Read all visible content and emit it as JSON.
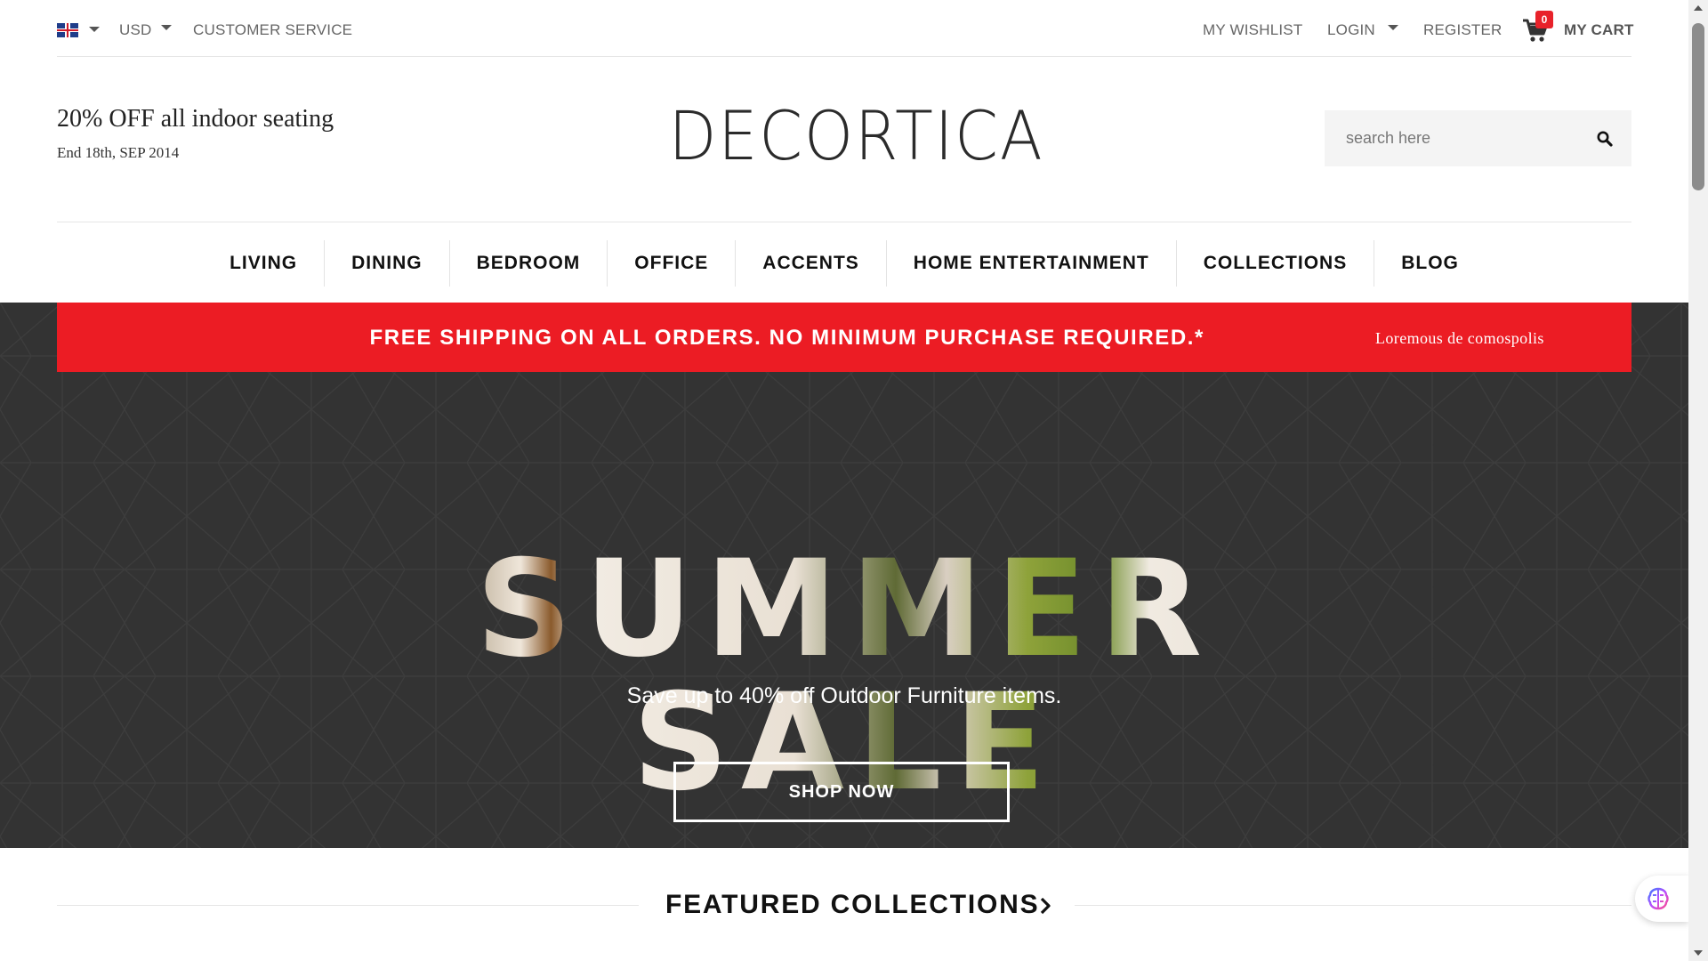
{
  "topbar": {
    "language_icon": "uk-flag-icon",
    "currency": "USD",
    "customer_service": "CUSTOMER SERVICE",
    "wishlist": "MY WISHLIST",
    "login": "LOGIN",
    "register": "REGISTER",
    "cart_count": "0",
    "cart_label": "MY CART"
  },
  "header": {
    "promo_title": "20% OFF all indoor seating",
    "promo_date": "End 18th, SEP 2014",
    "logo": "DECORTICA",
    "search_placeholder": "search here"
  },
  "nav": {
    "items": [
      {
        "label": "LIVING"
      },
      {
        "label": "DINING"
      },
      {
        "label": "BEDROOM"
      },
      {
        "label": "OFFICE"
      },
      {
        "label": "ACCENTS"
      },
      {
        "label": "HOME ENTERTAINMENT"
      },
      {
        "label": "COLLECTIONS"
      },
      {
        "label": "BLOG"
      }
    ]
  },
  "shipping_bar": {
    "message": "FREE SHIPPING ON ALL ORDERS. NO MINIMUM PURCHASE REQUIRED.*",
    "sub": "Loremous de comospolis"
  },
  "hero": {
    "headline": "SUMMER SALE",
    "subtitle": "Save up to 40% off Outdoor Furniture items.",
    "button": "SHOP NOW"
  },
  "featured": {
    "title": "FEATURED COLLECTIONS"
  },
  "colors": {
    "accent_red": "#ec1c24",
    "hero_bg": "#333333",
    "text_dark": "#111111"
  }
}
